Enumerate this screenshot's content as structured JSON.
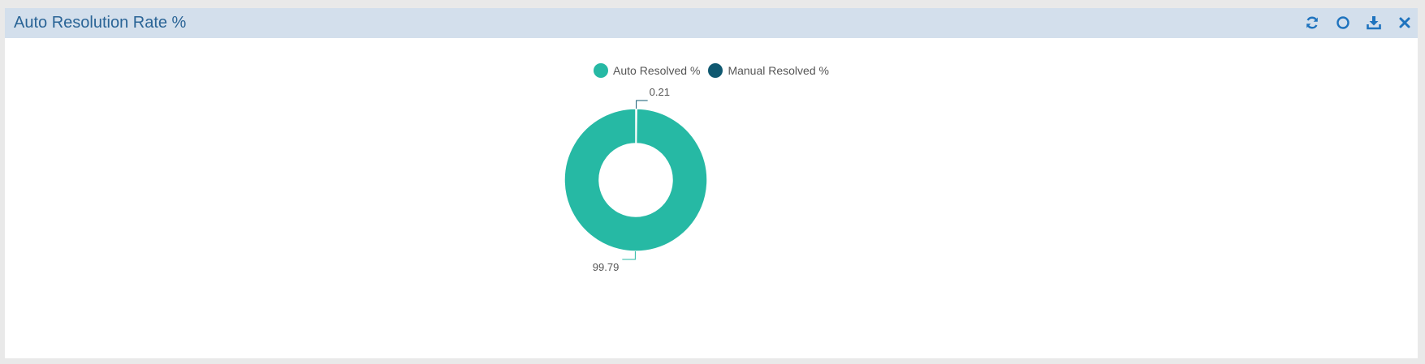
{
  "header": {
    "title": "Auto Resolution Rate %",
    "tools": [
      {
        "name": "refresh-icon"
      },
      {
        "name": "circle-icon"
      },
      {
        "name": "download-icon"
      },
      {
        "name": "close-icon"
      }
    ]
  },
  "colors": {
    "accent": "#1e73be",
    "header_bg": "#d3dfec",
    "auto": "#26b9a4",
    "manual": "#0f5870"
  },
  "chart_data": {
    "type": "pie",
    "variant": "donut",
    "title": "Auto Resolution Rate %",
    "legend_position": "top",
    "series": [
      {
        "name": "Auto Resolved %",
        "value": 99.79,
        "label": "99.79"
      },
      {
        "name": "Manual Resolved %",
        "value": 0.21,
        "label": "0.21"
      }
    ]
  }
}
